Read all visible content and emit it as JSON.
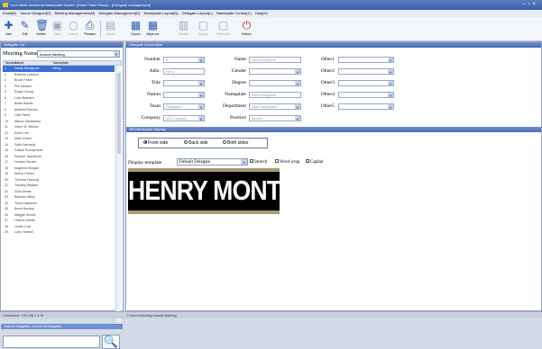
{
  "window": {
    "title": "Leco Multi-functional Nameplate System (Smart Table Home) - [Delegate management]"
  },
  "menu": [
    "Email(E)",
    "Venue Designer(D)",
    "Meeting Management(M)",
    "Delegate Management(D)",
    "Nameplate Layout(N)",
    "Delegate Layout(L)",
    "Nameplate Control(C)",
    "Help(H)"
  ],
  "toolbar": {
    "add": "Add",
    "edit": "Edit",
    "delete": "Delete",
    "save": "Save",
    "cancel": "Cancel",
    "preview": "Preview",
    "import": "Import",
    "export": "Export",
    "wipe_all": "Wipe out",
    "publish": "Publish",
    "display": "Display",
    "select_all": "Select All",
    "return": "Return"
  },
  "left": {
    "header": "Delegate List",
    "meeting_label": "Meeting Name",
    "meeting_value": "Annual Meeting",
    "col_number": "Number",
    "col_name": "Name",
    "col_abbr": "Nameplate",
    "delegates": [
      {
        "n": "1",
        "name": "Henry Montgome",
        "abbr": "Henry"
      },
      {
        "n": "2",
        "name": "Roberta Lambert",
        "abbr": ""
      },
      {
        "n": "3",
        "name": "Bruce Felton",
        "abbr": ""
      },
      {
        "n": "4",
        "name": "Phil Newton",
        "abbr": ""
      },
      {
        "n": "5",
        "name": "Roger Young",
        "abbr": ""
      },
      {
        "n": "6",
        "name": "Luke Barbara",
        "abbr": ""
      },
      {
        "n": "7",
        "name": "Blake Barber",
        "abbr": ""
      },
      {
        "n": "8",
        "name": "Andrew Reeves",
        "abbr": ""
      },
      {
        "n": "9",
        "name": "Otis Fisher",
        "abbr": ""
      },
      {
        "n": "10",
        "name": "Atticus Sandstrom",
        "abbr": ""
      },
      {
        "n": "11",
        "name": "Oliver W. Bishop",
        "abbr": ""
      },
      {
        "n": "12",
        "name": "Kevin Lee",
        "abbr": ""
      },
      {
        "n": "13",
        "name": "Mark Green",
        "abbr": ""
      },
      {
        "n": "14",
        "name": "Sofia Yarowski",
        "abbr": ""
      },
      {
        "n": "15",
        "name": "Cassie Runnymede",
        "abbr": ""
      },
      {
        "n": "16",
        "name": "Samuel Yamamoto",
        "abbr": ""
      },
      {
        "n": "17",
        "name": "Hudson Becker",
        "abbr": ""
      },
      {
        "n": "18",
        "name": "Angelina Morgan",
        "abbr": ""
      },
      {
        "n": "19",
        "name": "Verton Parker",
        "abbr": ""
      },
      {
        "n": "20",
        "name": "Thomas Fanning",
        "abbr": ""
      },
      {
        "n": "21",
        "name": "Timothy Wallace",
        "abbr": ""
      },
      {
        "n": "22",
        "name": "Gina Ulman",
        "abbr": ""
      },
      {
        "n": "23",
        "name": "Blanche Wiley",
        "abbr": ""
      },
      {
        "n": "24",
        "name": "Tonia Lawrence",
        "abbr": ""
      },
      {
        "n": "25",
        "name": "Brent Howard",
        "abbr": ""
      },
      {
        "n": "26",
        "name": "Maggie Scholz",
        "abbr": ""
      },
      {
        "n": "27",
        "name": "Helena Voerts",
        "abbr": ""
      },
      {
        "n": "28",
        "name": "Yvette Cole",
        "abbr": ""
      },
      {
        "n": "29",
        "name": "Larry Yentsel",
        "abbr": ""
      }
    ],
    "footer": "Total 43 Delegates, Current 43 Delegates",
    "search_placeholder": ""
  },
  "info": {
    "header": "Delegate Information",
    "number_label": "Number",
    "number_value": "1",
    "abbr_label": "Abbr.",
    "abbr_value": "Henry",
    "title_label": "Title",
    "title_value": "",
    "nation_label": "Nation",
    "nation_value": "",
    "team_label": "Team",
    "team_value": "Delegation",
    "company_label": "Company",
    "company_value": "ABC Company",
    "name_label": "Name",
    "name_value": "Henry Montgome",
    "gender_label": "Gender",
    "gender_value": "",
    "degree_label": "Degree",
    "degree_value": "",
    "nameplate_label": "Nameplate",
    "nameplate_value": "Henry Montgome",
    "department_label": "Department",
    "department_value": "Sales Department",
    "position_label": "Position",
    "position_value": "Director",
    "other1_label": "Other1",
    "other2_label": "Other2",
    "other3_label": "Other3",
    "other4_label": "Other4",
    "other5_label": "Other5"
  },
  "display": {
    "header": "Set Nameplate Display",
    "front_side": "Front side",
    "back_side": "Back side",
    "both_sides": "Both sides",
    "template_label": "Display template",
    "template_value": "Default Delegate",
    "stretch": "Stretch",
    "word_wrap": "Word wrap",
    "capital": "Capital",
    "preview_text": "HENRY MONTGOME"
  },
  "status": {
    "connected": "Connected: 192.168.1.178",
    "current": "Current Meeting:Annual Meeting"
  },
  "colors": {
    "selection": "#3a6fd4",
    "header": "#4a6db2",
    "plate_bg": "#000000",
    "plate_bar": "#a89a7a"
  }
}
